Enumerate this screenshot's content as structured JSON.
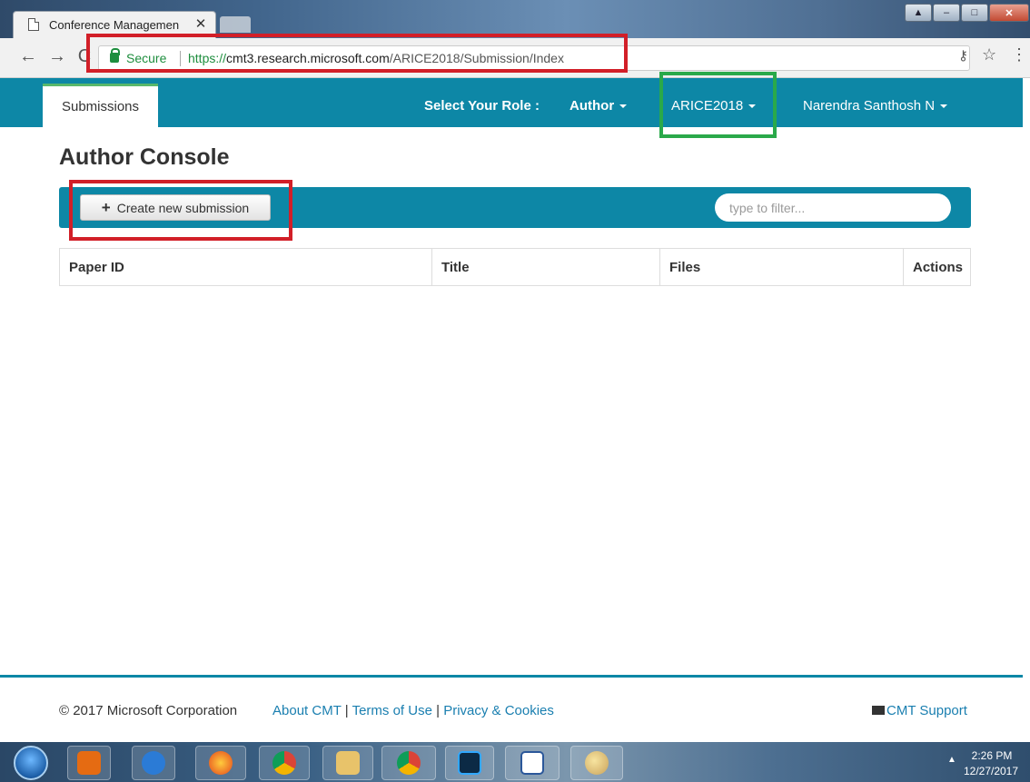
{
  "browser": {
    "tab_title": "Conference Managemen",
    "tab_close": "✕",
    "secure_label": "Secure",
    "url_protocol": "https://",
    "url_domain": "cmt3.research.microsoft.com",
    "url_path": "/ARICE2018/Submission/Index",
    "back_icon": "←",
    "forward_icon": "→",
    "reload_icon": "C",
    "key_icon": "⚷",
    "star_icon": "☆",
    "menu_icon": "⋮",
    "window_controls": {
      "upload": "▲",
      "minimize": "–",
      "maximize": "□",
      "close": "✕"
    }
  },
  "nav": {
    "submissions_tab": "Submissions",
    "role_label": "Select Your Role :",
    "role_value": "Author",
    "conference": "ARICE2018",
    "user": "Narendra Santhosh N"
  },
  "page": {
    "title": "Author Console",
    "create_button": "Create new submission",
    "create_icon": "+",
    "filter_placeholder": "type to filter..."
  },
  "table": {
    "headers": [
      "Paper ID",
      "Title",
      "Files",
      "Actions"
    ]
  },
  "footer": {
    "copyright": "© 2017 Microsoft Corporation",
    "about": "About CMT",
    "separator": "|",
    "terms": "Terms of Use",
    "privacy": "Privacy & Cookies",
    "support": "CMT Support"
  },
  "taskbar": {
    "time": "2:26 PM",
    "date": "12/27/2017",
    "tray_arrow": "▲",
    "apps": [
      "windows-media-center-icon",
      "internet-explorer-icon",
      "firefox-icon",
      "chrome-icon",
      "file-explorer-icon",
      "chrome-icon",
      "photoshop-icon",
      "word-icon",
      "paint-icon"
    ]
  },
  "annotation_colors": {
    "red": "#d21f28",
    "green": "#2aa94a"
  },
  "brand_color": "#0d87a6"
}
